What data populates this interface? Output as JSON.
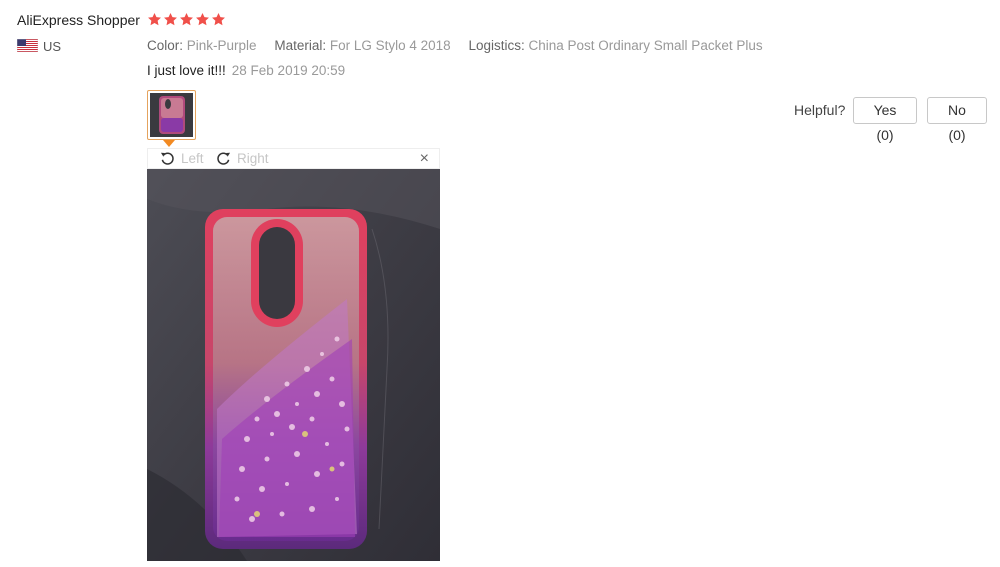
{
  "reviewer": {
    "name": "AliExpress Shopper",
    "country_code": "US",
    "rating": 5,
    "star_color": "#f0504a"
  },
  "attributes": [
    {
      "key": "Color:",
      "value": "Pink-Purple"
    },
    {
      "key": "Material:",
      "value": "For LG Stylo 4 2018"
    },
    {
      "key": "Logistics:",
      "value": "China Post Ordinary Small Packet Plus"
    }
  ],
  "review": {
    "text": "I just love it!!!",
    "date": "28 Feb 2019 20:59"
  },
  "helpful": {
    "label": "Helpful?",
    "yes": "Yes (0)",
    "no": "No (0)"
  },
  "viewer": {
    "rotate_left": "Left",
    "rotate_right": "Right",
    "close": "×"
  },
  "icons": {
    "flag": "us-flag-icon",
    "star": "star-icon",
    "rotate_left": "rotate-left-icon",
    "rotate_right": "rotate-right-icon",
    "close": "close-icon"
  },
  "colors": {
    "thumb_border": "#e5a35d",
    "thumb_caret": "#f28a22"
  }
}
